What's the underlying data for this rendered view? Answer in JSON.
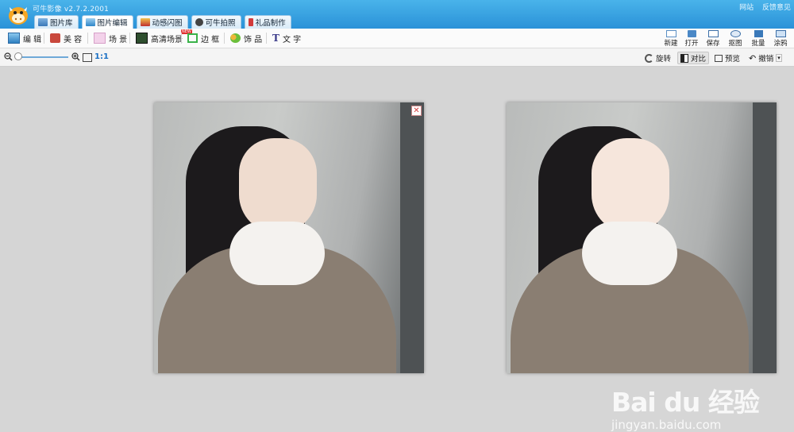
{
  "app": {
    "title": "可牛影像 v2.7.2.2001",
    "top_right": [
      "网站",
      "反馈意见"
    ]
  },
  "tabs": [
    {
      "label": "图片库",
      "active": false,
      "icon": "gallery-icon"
    },
    {
      "label": "图片编辑",
      "active": true,
      "icon": "image-edit-icon"
    },
    {
      "label": "动感闪图",
      "active": false,
      "icon": "animation-icon"
    },
    {
      "label": "可牛拍照",
      "active": false,
      "icon": "camera-icon"
    },
    {
      "label": "礼品制作",
      "active": false,
      "icon": "gift-icon"
    }
  ],
  "toolbar1": {
    "tools": [
      {
        "label": "编 辑",
        "icon": "edit-icon"
      },
      {
        "label": "美 容",
        "icon": "beauty-icon"
      },
      {
        "label": "场 景",
        "icon": "scene-icon"
      },
      {
        "label": "高清场景",
        "icon": "hd-scene-icon",
        "badge": "NEW"
      },
      {
        "label": "边 框",
        "icon": "frame-icon"
      },
      {
        "label": "饰 品",
        "icon": "decoration-icon"
      },
      {
        "label": "文 字",
        "icon": "text-icon"
      }
    ],
    "right_buttons": [
      {
        "label": "新建",
        "icon": "new-file-icon"
      },
      {
        "label": "打开",
        "icon": "open-folder-icon"
      },
      {
        "label": "保存",
        "icon": "save-icon"
      },
      {
        "label": "抠图",
        "icon": "cutout-icon"
      },
      {
        "label": "批量",
        "icon": "batch-icon"
      },
      {
        "label": "涂鸦",
        "icon": "doodle-icon"
      }
    ]
  },
  "toolbar2": {
    "zoom_1to1": "1:1",
    "rotate": "旋转",
    "compare": "对比",
    "preview": "预览",
    "undo": "撤销"
  },
  "colors": {
    "title_bar": "#2a92d8",
    "accent_text": "#1a6fc4",
    "canvas_bg": "#d5d5d5"
  },
  "watermark": {
    "logo_text": "Bai du 经验",
    "url": "jingyan.baidu.com"
  }
}
